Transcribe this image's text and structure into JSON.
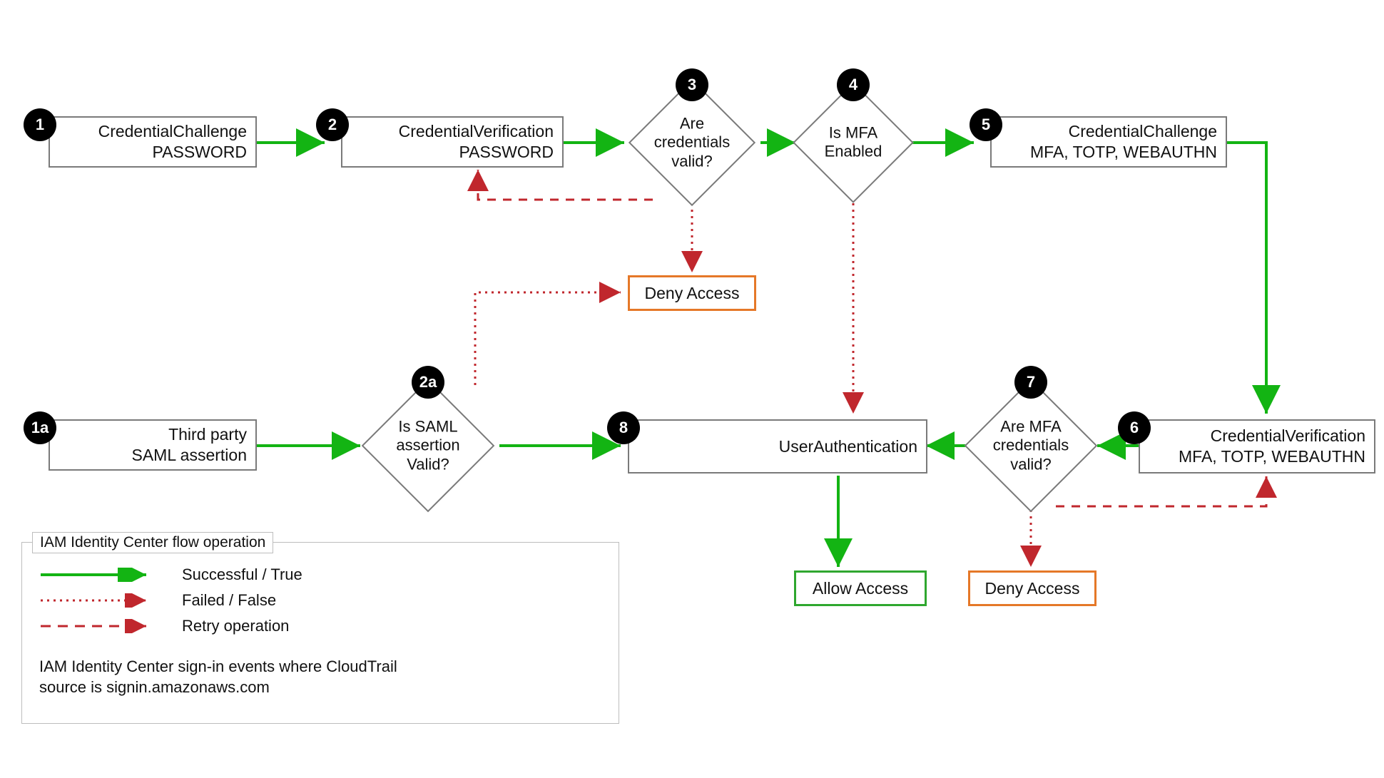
{
  "nodes": {
    "n1": {
      "badge": "1",
      "line1": "CredentialChallenge",
      "line2": "PASSWORD"
    },
    "n2": {
      "badge": "2",
      "line1": "CredentialVerification",
      "line2": "PASSWORD"
    },
    "n3": {
      "badge": "3",
      "line1": "Are",
      "line2": "credentials",
      "line3": "valid?"
    },
    "n4": {
      "badge": "4",
      "line1": "Is MFA",
      "line2": "Enabled"
    },
    "n5": {
      "badge": "5",
      "line1": "CredentialChallenge",
      "line2": "MFA, TOTP, WEBAUTHN"
    },
    "n6": {
      "badge": "6",
      "line1": "CredentialVerification",
      "line2": "MFA, TOTP, WEBAUTHN"
    },
    "n7": {
      "badge": "7",
      "line1": "Are MFA",
      "line2": "credentials",
      "line3": "valid?"
    },
    "n8": {
      "badge": "8",
      "line1": "UserAuthentication"
    },
    "n1a": {
      "badge": "1a",
      "line1": "Third party",
      "line2": "SAML assertion"
    },
    "n2a": {
      "badge": "2a",
      "line1": "Is SAML",
      "line2": "assertion",
      "line3": "Valid?"
    }
  },
  "outcomes": {
    "deny_top": "Deny Access",
    "allow": "Allow Access",
    "deny_bottom": "Deny Access"
  },
  "legend": {
    "title": "IAM Identity Center flow operation",
    "success": "Successful / True",
    "failed": "Failed / False",
    "retry": "Retry operation",
    "footer1": "IAM Identity Center sign-in events where CloudTrail",
    "footer2": "source is signin.amazonaws.com"
  },
  "colors": {
    "green": "#13b413",
    "red": "#c0272d",
    "orange": "#e57828"
  }
}
